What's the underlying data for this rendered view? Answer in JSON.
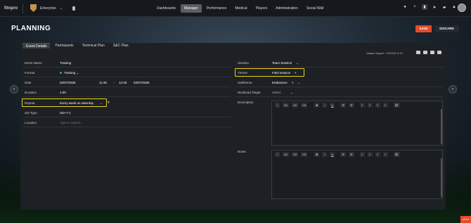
{
  "brand": {
    "logo_text": "fitnpro",
    "org": "Enterprise"
  },
  "nav": {
    "tabs": [
      "Dashboards",
      "Manager",
      "Performance",
      "Medical",
      "Players",
      "Administration",
      "Social Wall"
    ],
    "active": "Manager"
  },
  "header_icons": [
    "info-icon",
    "plus-icon",
    "doc-icon",
    "send-icon",
    "chat-icon",
    "bell-icon"
  ],
  "page": {
    "title": "PLANNING",
    "save": "SAVE",
    "discard": "DISCARD"
  },
  "tabs": {
    "items": [
      "Event Details",
      "Participants",
      "Technical Plan",
      "S&C Plan"
    ],
    "active": "Event Details"
  },
  "meta": {
    "text": "Vasjazo Support  ·  02/20/26 11:15"
  },
  "form_left": {
    "event_name": {
      "label": "Event Name",
      "value": "Training"
    },
    "format": {
      "label": "Format",
      "value": "Training"
    },
    "date": {
      "label": "Date",
      "start_date": "02/07/2026",
      "start_time": "11:30",
      "dash": "-",
      "end_time": "12:30",
      "end_date": "02/07/2026"
    },
    "duration": {
      "label": "Duration",
      "value": "1:00"
    },
    "repeat": {
      "label": "Repeat",
      "value": "Every week on saturday",
      "help": "?"
    },
    "gd_type": {
      "label": "GD Type",
      "value": "GD+7-1"
    },
    "location": {
      "label": "Location",
      "placeholder": "Type to search..."
    }
  },
  "form_right": {
    "session": {
      "label": "Session",
      "value": "Team Session"
    },
    "theme": {
      "label": "Theme",
      "value": "Field session",
      "remove": "×"
    },
    "subtheme": {
      "label": "Subtheme",
      "value": "Endurance",
      "remove": "×"
    },
    "workload_target": {
      "label": "Workload Target",
      "placeholder": "Select"
    },
    "description": {
      "label": "Description"
    },
    "notes": {
      "label": "Notes"
    }
  },
  "toolbar": [
    "H1",
    "H2",
    "H3",
    "B",
    "I",
    "U"
  ],
  "version": "v13.2",
  "colors": {
    "accent": "#e84b2a",
    "highlight": "#e8d21c",
    "active_dot": "#3cb043"
  }
}
